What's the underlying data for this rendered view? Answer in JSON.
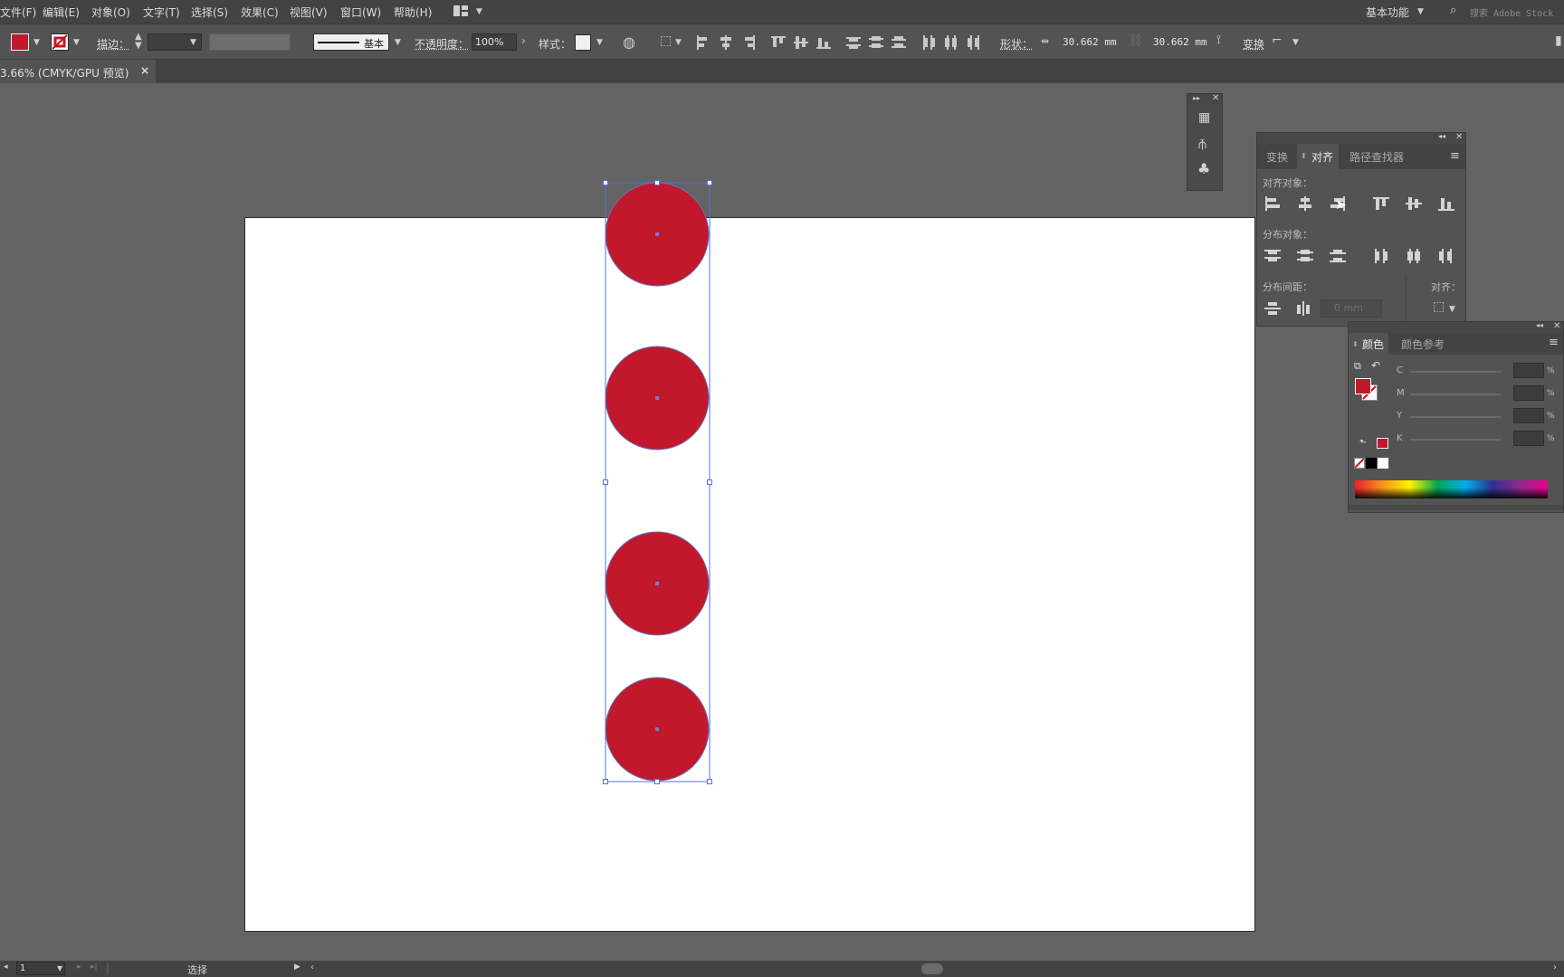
{
  "menubar": {
    "items": [
      "文件(F)",
      "编辑(E)",
      "对象(O)",
      "文字(T)",
      "选择(S)",
      "效果(C)",
      "视图(V)",
      "窗口(W)",
      "帮助(H)"
    ],
    "workspace": "基本功能",
    "search_placeholder": "搜索 Adobe Stock"
  },
  "controlbar": {
    "stroke_label": "描边：",
    "brush_label": "基本",
    "opacity_label": "不透明度：",
    "opacity_value": "100%",
    "style_label": "样式：",
    "shape_label": "形状：",
    "width_value": "30.662 mm",
    "height_value": "30.662 mm",
    "transform_label": "变换",
    "fill_color": "#c1182b"
  },
  "document": {
    "tab_title": "3.66% (CMYK/GPU 预览)",
    "close": "×"
  },
  "align_panel": {
    "tabs": [
      "变换",
      "对齐",
      "路径查找器"
    ],
    "align_objects_label": "对齐对象：",
    "distribute_objects_label": "分布对象：",
    "distribute_spacing_label": "分布间距：",
    "align_to_label": "对齐：",
    "spacing_value": "0 mm"
  },
  "color_panel": {
    "tabs": [
      "颜色",
      "颜色参考"
    ],
    "channels": [
      "C",
      "M",
      "Y",
      "K"
    ],
    "percent": "%"
  },
  "statusbar": {
    "page": "1",
    "tool": "选择"
  },
  "artwork": {
    "circle_color": "#c1182b",
    "circle_count": 4
  }
}
